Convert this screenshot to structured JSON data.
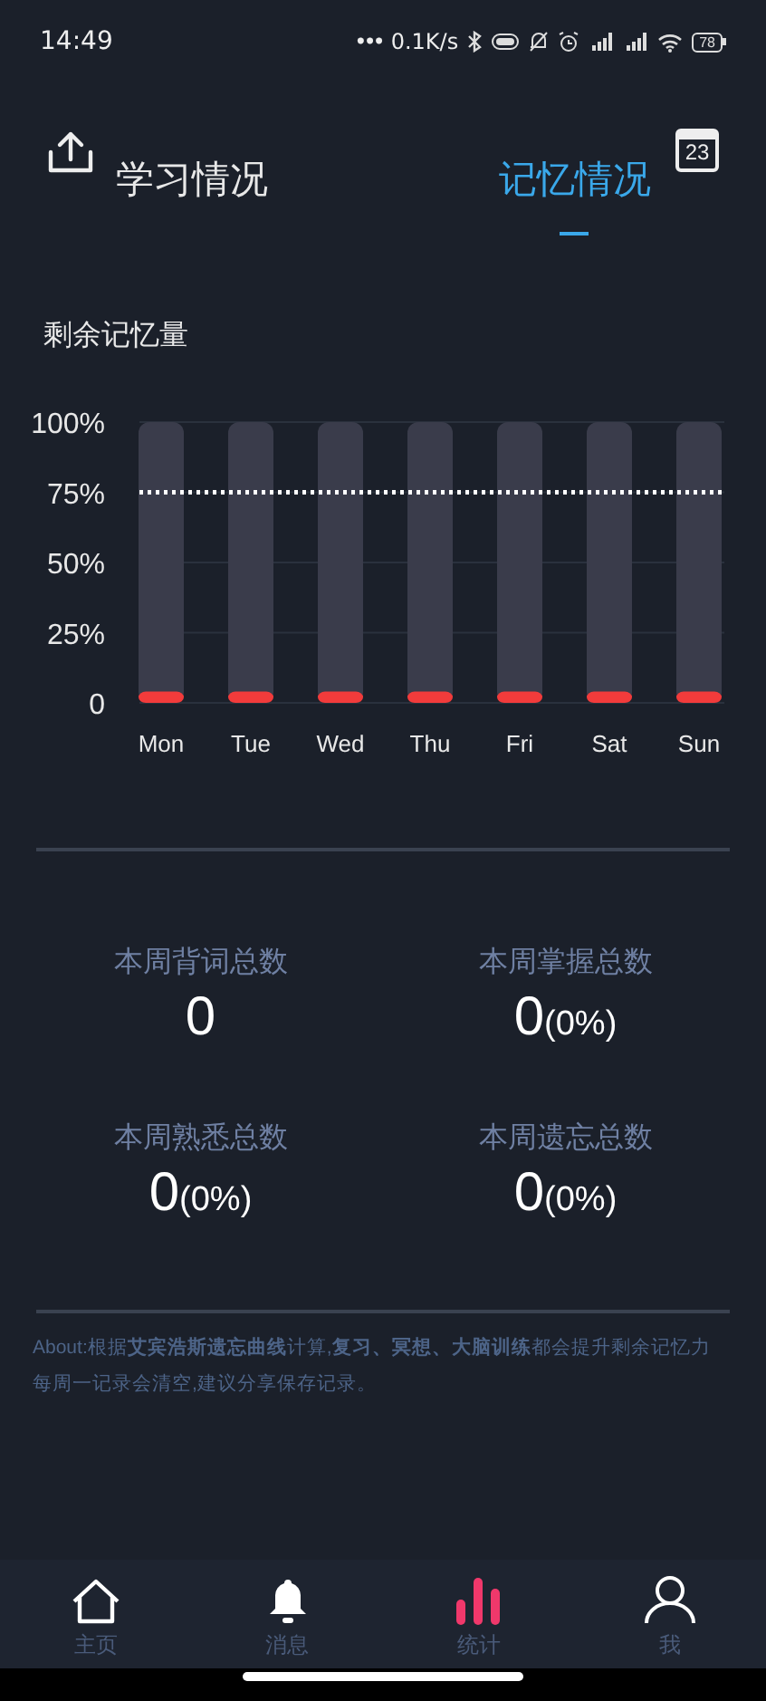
{
  "status_bar": {
    "time": "14:49",
    "activity_dots": "•••",
    "network_speed": "0.1K/s",
    "battery": "78"
  },
  "header": {
    "calendar_day": "23",
    "tabs": [
      {
        "label": "学习情况",
        "selected": false
      },
      {
        "label": "记忆情况",
        "selected": true
      }
    ]
  },
  "memory_chart": {
    "chart_data": {
      "type": "bar",
      "title": "剩余记忆量",
      "categories": [
        "Mon",
        "Tue",
        "Wed",
        "Thu",
        "Fri",
        "Sat",
        "Sun"
      ],
      "grid": true,
      "series": [
        {
          "color": "#f23b3b",
          "values": [
            4,
            4,
            4,
            4,
            4,
            4,
            4
          ]
        }
      ],
      "ylim": [
        0,
        100
      ],
      "yticks": [
        {
          "value": 0,
          "label": "0"
        },
        {
          "value": 25,
          "label": "25%"
        },
        {
          "value": 50,
          "label": "50%"
        },
        {
          "value": 75,
          "label": "75%"
        },
        {
          "value": 100,
          "label": "100%"
        }
      ],
      "ref_lines": [
        {
          "axis": "y",
          "value": 75,
          "color": "#ffffff"
        }
      ]
    }
  },
  "stats": [
    {
      "label": "本周背词总数",
      "value": "0"
    },
    {
      "label": "本周掌握总数",
      "value": "0",
      "percent": "(0%)"
    },
    {
      "label": "本周熟悉总数",
      "value": "0",
      "percent": "(0%)"
    },
    {
      "label": "本周遗忘总数",
      "value": "0",
      "percent": "(0%)"
    }
  ],
  "about": [
    "About:根据**艾宾浩斯遗忘曲线**计算,**复习、冥想、大脑训练**都会提升剩余记忆力",
    "每周一记录会清空,建议分享保存记录。"
  ],
  "bottom_nav": [
    {
      "label": "主页",
      "selected": false
    },
    {
      "label": "消息",
      "selected": false
    },
    {
      "label": "统计",
      "selected": true
    },
    {
      "label": "我",
      "selected": false
    }
  ]
}
